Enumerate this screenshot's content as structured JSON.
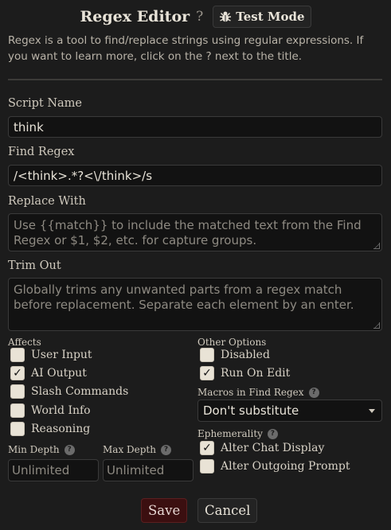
{
  "header": {
    "title": "Regex Editor",
    "help_glyph": "?",
    "test_mode_label": "Test Mode",
    "test_mode_icon": "bug-icon"
  },
  "intro_text": "Regex is a tool to find/replace strings using regular expressions. If you want to learn more, click on the ? next to the title.",
  "script_name": {
    "label": "Script Name",
    "value": "think"
  },
  "find_regex": {
    "label": "Find Regex",
    "value": "/<think>.*?<\\/think>/s"
  },
  "replace_with": {
    "label": "Replace With",
    "placeholder": "Use {{match}} to include the matched text from the Find Regex or $1, $2, etc. for capture groups."
  },
  "trim_out": {
    "label": "Trim Out",
    "placeholder": "Globally trims any unwanted parts from a regex match before replacement. Separate each element by an enter."
  },
  "affects": {
    "label": "Affects",
    "items": [
      {
        "label": "User Input",
        "checked": false
      },
      {
        "label": "AI Output",
        "checked": true
      },
      {
        "label": "Slash Commands",
        "checked": false
      },
      {
        "label": "World Info",
        "checked": false
      },
      {
        "label": "Reasoning",
        "checked": false
      }
    ]
  },
  "other_options": {
    "label": "Other Options",
    "items": [
      {
        "label": "Disabled",
        "checked": false
      },
      {
        "label": "Run On Edit",
        "checked": true
      }
    ]
  },
  "macros": {
    "label": "Macros in Find Regex",
    "selected": "Don't substitute"
  },
  "ephemerality": {
    "label": "Ephemerality",
    "items": [
      {
        "label": "Alter Chat Display",
        "checked": true
      },
      {
        "label": "Alter Outgoing Prompt",
        "checked": false
      }
    ]
  },
  "min_depth": {
    "label": "Min Depth",
    "placeholder": "Unlimited"
  },
  "max_depth": {
    "label": "Max Depth",
    "placeholder": "Unlimited"
  },
  "hint_glyph": "?",
  "check_glyph": "✓",
  "buttons": {
    "save": "Save",
    "cancel": "Cancel"
  }
}
